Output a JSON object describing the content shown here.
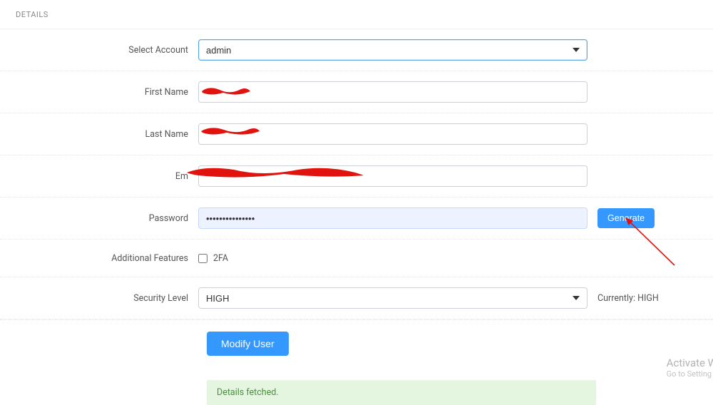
{
  "section_title": "DETAILS",
  "account": {
    "label": "Select Account",
    "selected": "admin"
  },
  "first_name": {
    "label": "First Name",
    "value": ""
  },
  "last_name": {
    "label": "Last Name",
    "value": ""
  },
  "email": {
    "label": "Em",
    "value": ""
  },
  "password": {
    "label": "Password",
    "value": "•••••••••••••••",
    "generate_label": "Generate"
  },
  "additional_features": {
    "label": "Additional Features",
    "option_2fa": "2FA",
    "checked": false
  },
  "security_level": {
    "label": "Security Level",
    "selected": "HIGH",
    "current_label": "Currently: HIGH"
  },
  "submit_label": "Modify User",
  "status_message": "Details fetched.",
  "watermark": {
    "title": "Activate W",
    "sub": "Go to Setting"
  }
}
